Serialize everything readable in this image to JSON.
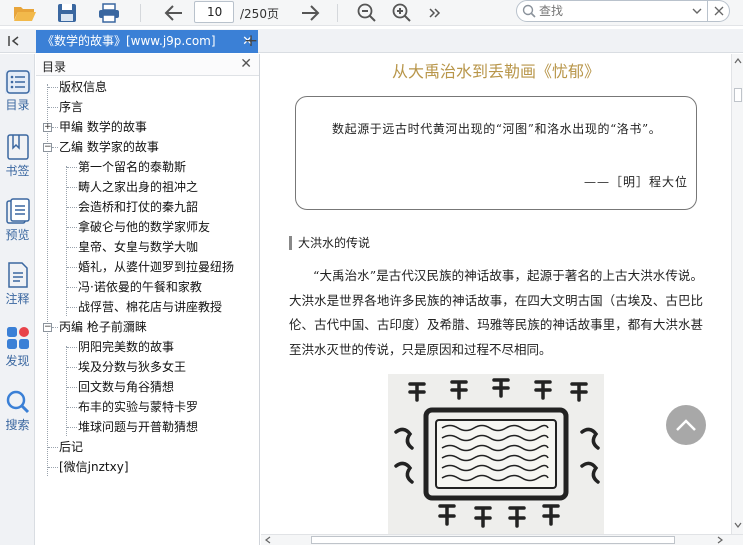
{
  "toolbar": {
    "page_current": "10",
    "page_total": "/250页",
    "search_placeholder": "查找"
  },
  "tab": {
    "title": "《数学的故事》[www.j9p.com]"
  },
  "sidebar": {
    "items": [
      {
        "label": "目录",
        "icon": "toc-icon"
      },
      {
        "label": "书签",
        "icon": "bookmark-icon"
      },
      {
        "label": "预览",
        "icon": "preview-icon"
      },
      {
        "label": "注释",
        "icon": "annotation-icon"
      },
      {
        "label": "发现",
        "icon": "discover-icon"
      },
      {
        "label": "搜索",
        "icon": "search-icon"
      }
    ]
  },
  "outline": {
    "title": "目录",
    "items": [
      "版权信息",
      "序言",
      "甲编 数学的故事",
      "乙编 数学家的故事",
      "第一个留名的泰勒斯",
      "畴人之家出身的祖冲之",
      "会造桥和打仗的秦九韶",
      "拿破仑与他的数学家师友",
      "皇帝、女皇与数学大咖",
      "婚礼，从婆什迦罗到拉曼纽扬",
      "冯·诺依曼的午餐和家教",
      "战俘营、棉花店与讲座教授",
      "丙编 枪子前瀰睐",
      "阴阳完美数的故事",
      "埃及分数与狄多女王",
      "回文数与角谷猜想",
      "布丰的实验与蒙特卡罗",
      "堆球问题与开普勒猜想",
      "后记",
      "[微信jnztxy]"
    ]
  },
  "document": {
    "chapter_title": "从大禹治水到丢勒画《忧郁》",
    "quote": "数起源于远古时代黄河出现的“河图”和洛水出现的“洛书”。",
    "quote_source": "——［明］程大位",
    "section_head": "大洪水的传说",
    "paragraph": "“大禹治水”是古代汉民族的神话故事，起源于著名的上古大洪水传说。大洪水是世界各地许多民族的神话故事，在四大文明古国（古埃及、古巴比伦、古代中国、古印度）及希腊、玛雅等民族的神话故事里，都有大洪水甚至洪水灭世的传说，只是原因和过程不尽相同。"
  },
  "colors": {
    "accent": "#3b80d6",
    "title_gold": "#b8964a",
    "side_label": "#3a67a0"
  }
}
